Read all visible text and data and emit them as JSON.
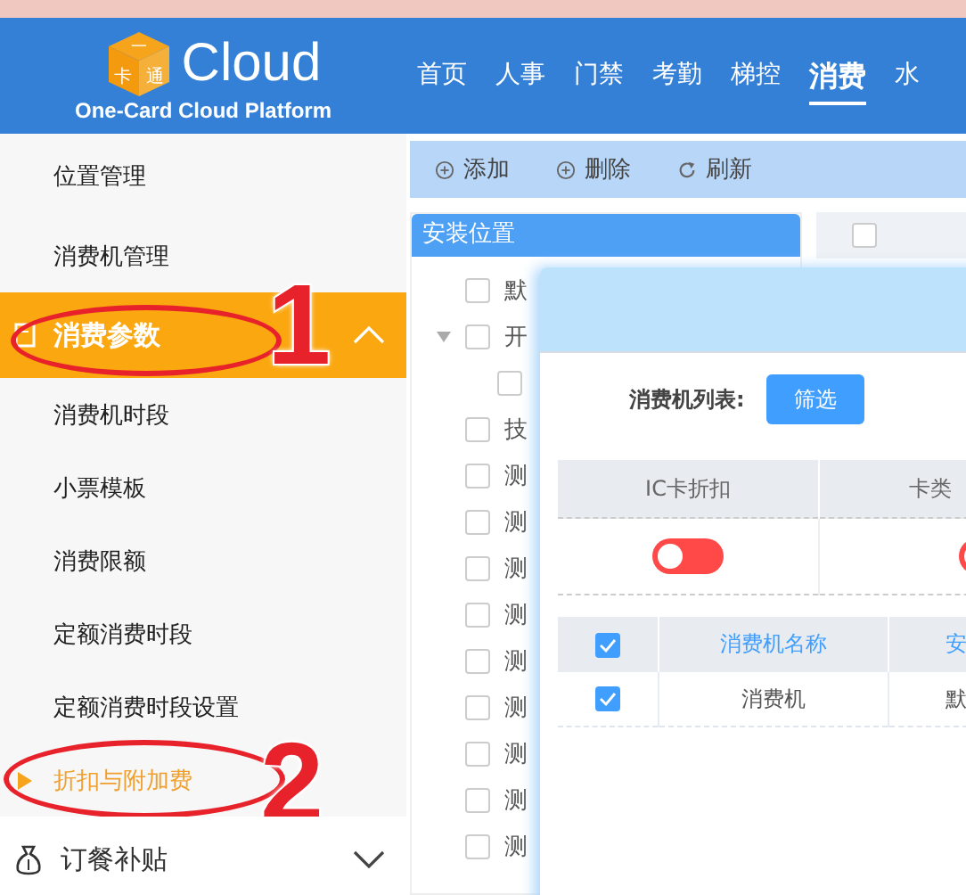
{
  "header": {
    "logo_chars": [
      "一",
      "卡",
      "通"
    ],
    "logo_text": "Cloud",
    "tagline": "One-Card Cloud Platform",
    "nav": [
      {
        "label": "首页",
        "selected": false
      },
      {
        "label": "人事",
        "selected": false
      },
      {
        "label": "门禁",
        "selected": false
      },
      {
        "label": "考勤",
        "selected": false
      },
      {
        "label": "梯控",
        "selected": false
      },
      {
        "label": "消费",
        "selected": true
      },
      {
        "label": "水",
        "selected": false
      }
    ]
  },
  "sidebar": {
    "items": [
      {
        "kind": "item",
        "label": "位置管理"
      },
      {
        "kind": "item",
        "label": "消费机管理"
      },
      {
        "kind": "group",
        "label": "消费参数",
        "expanded": true,
        "annotation": "1",
        "children": [
          {
            "label": "消费机时段",
            "selected": false
          },
          {
            "label": "小票模板",
            "selected": false
          },
          {
            "label": "消费限额",
            "selected": false
          },
          {
            "label": "定额消费时段",
            "selected": false
          },
          {
            "label": "定额消费时段设置",
            "selected": false
          },
          {
            "label": "折扣与附加费",
            "selected": true,
            "annotation": "2"
          }
        ]
      },
      {
        "kind": "group",
        "label": "订餐补贴",
        "expanded": false
      }
    ]
  },
  "toolbar": [
    {
      "kind": "add",
      "label": "添加"
    },
    {
      "kind": "delete",
      "label": "删除"
    },
    {
      "kind": "refresh",
      "label": "刷新"
    }
  ],
  "tree": {
    "title": "安装位置",
    "nodes": [
      {
        "label": "默",
        "checked": false
      },
      {
        "label": "开",
        "checked": false,
        "expanded": true,
        "children": [
          {
            "checked": false
          }
        ]
      },
      {
        "label": "技",
        "checked": false
      },
      {
        "label": "测",
        "checked": false
      },
      {
        "label": "测",
        "checked": false
      },
      {
        "label": "测",
        "checked": false
      },
      {
        "label": "测",
        "checked": false
      },
      {
        "label": "测",
        "checked": false
      },
      {
        "label": "测",
        "checked": false
      },
      {
        "label": "测",
        "checked": false
      },
      {
        "label": "测",
        "checked": false
      },
      {
        "label": "测",
        "checked": false
      }
    ]
  },
  "grid": {
    "all_checked": false
  },
  "dialog": {
    "filter_label": "消费机列表:",
    "filter_button": "筛选",
    "settings": {
      "columns": [
        "IC卡折扣",
        "卡类"
      ],
      "toggles": [
        {
          "on": false
        },
        {
          "on": false
        }
      ]
    },
    "machines": {
      "all_checked": true,
      "columns": [
        "消费机名称",
        "安"
      ],
      "rows": [
        {
          "checked": true,
          "cells": [
            "消费机",
            "默"
          ]
        }
      ]
    }
  }
}
